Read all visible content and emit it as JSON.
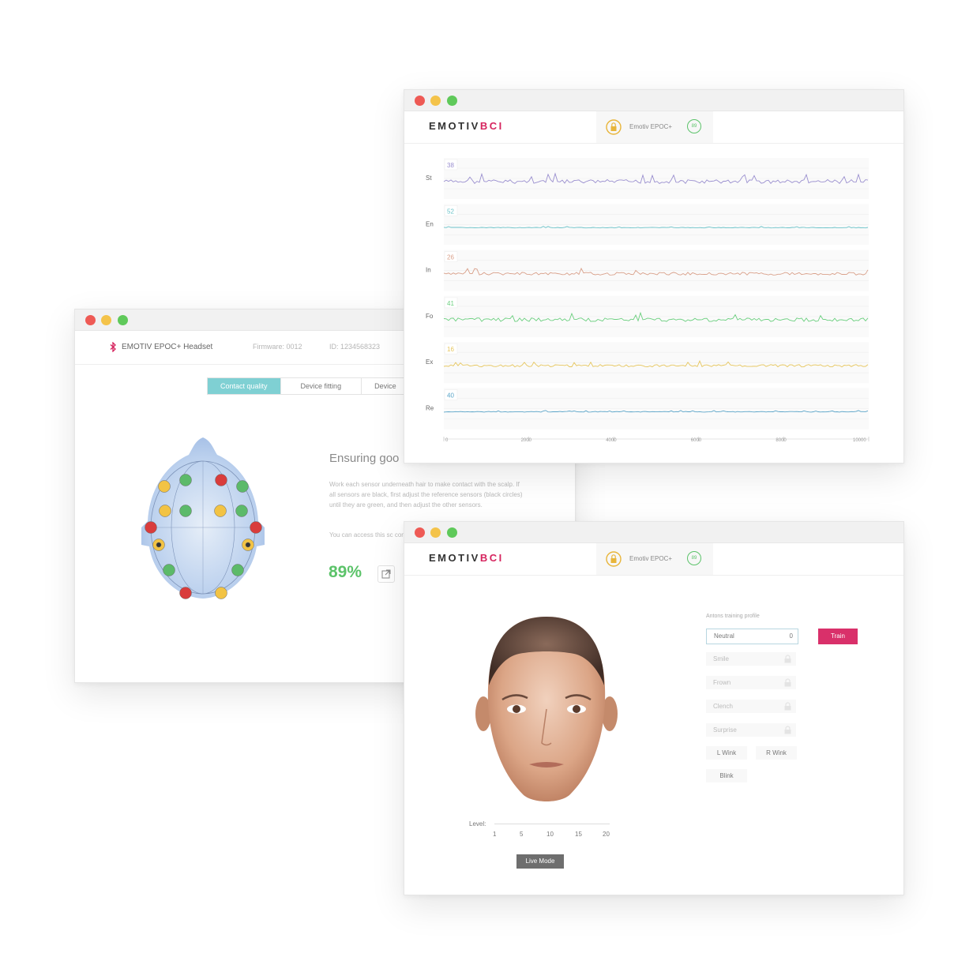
{
  "contact_window": {
    "header": {
      "device_name": "EMOTIV EPOC+ Headset",
      "firmware": "Firmware: 0012",
      "id": "ID: 1234568323"
    },
    "tabs": [
      "Contact quality",
      "Device fitting",
      "Device"
    ],
    "title": "Ensuring goo",
    "paragraph1": "Work each sensor underneath hair to make contact with the scalp. If all sensors are black, first adjust the reference sensors (black circles) until they are green, and then adjust the other sensors.",
    "paragraph2": "You can access this sc contact quality meter",
    "percentage": "89%",
    "sensor_colors": {
      "green": "#5cba6a",
      "yellow": "#f2c344",
      "red": "#d93c3c"
    }
  },
  "eeg_window": {
    "logo_main": "EMOTIV",
    "logo_accent": "BCI",
    "device": "Emotiv EPOC+",
    "battery": "89",
    "chart_data": {
      "type": "line",
      "x_ticks": [
        "0",
        "2000",
        "4000",
        "6000",
        "8000",
        "10000"
      ],
      "xlim": [
        0,
        10000
      ],
      "series": [
        {
          "label": "St",
          "value": "38",
          "color": "#9a8fcf"
        },
        {
          "label": "En",
          "value": "52",
          "color": "#6cc3c9"
        },
        {
          "label": "In",
          "value": "26",
          "color": "#d9a08a"
        },
        {
          "label": "Fo",
          "value": "41",
          "color": "#6bcf7f"
        },
        {
          "label": "Ex",
          "value": "16",
          "color": "#e6c65d"
        },
        {
          "label": "Re",
          "value": "40",
          "color": "#5aa4c8"
        }
      ]
    }
  },
  "facial_window": {
    "logo_main": "EMOTIV",
    "logo_accent": "BCI",
    "device": "Emotiv EPOC+",
    "battery": "89",
    "level_label": "Level:",
    "level_ticks": [
      "1",
      "5",
      "10",
      "15",
      "20"
    ],
    "live_mode": "Live Mode",
    "profile_label": "Antons training profile",
    "neutral": {
      "label": "Neutral",
      "count": "0"
    },
    "train": "Train",
    "locked_actions": [
      "Smile",
      "Frown",
      "Clench",
      "Surprise"
    ],
    "l_wink": "L Wink",
    "r_wink": "R Wink",
    "blink": "Blink"
  }
}
